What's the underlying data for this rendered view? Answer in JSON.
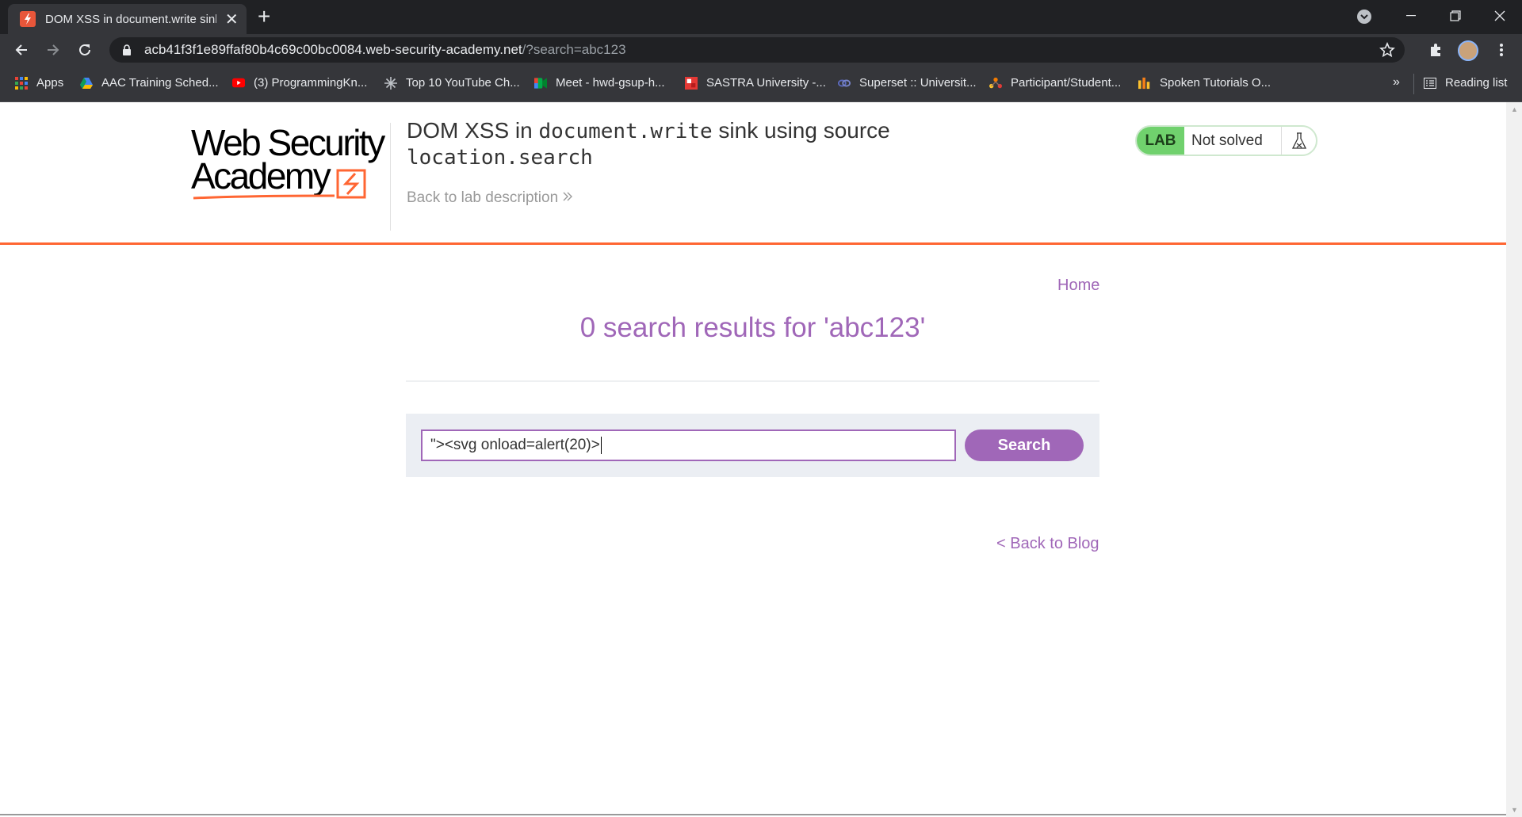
{
  "browser": {
    "tab": {
      "title": "DOM XSS in document.write sink",
      "close_glyph": "✕"
    },
    "new_tab_glyph": "+",
    "address": {
      "host": "acb41f3f1e89ffaf80b4c69c00bc0084.web-security-academy.net",
      "path": "/?search=abc123"
    },
    "bookmarks": [
      {
        "label": "Apps",
        "icon": "apps-grid-icon",
        "color": "#4285f4"
      },
      {
        "label": "AAC Training Sched...",
        "icon": "google-drive-icon",
        "color": "#4285f4"
      },
      {
        "label": "(3) ProgrammingKn...",
        "icon": "youtube-icon",
        "color": "#ff0000"
      },
      {
        "label": "Top 10 YouTube Ch...",
        "icon": "sparkle-icon",
        "color": "#bdc1c6"
      },
      {
        "label": "Meet - hwd-gsup-h...",
        "icon": "google-meet-icon",
        "color": "#00ac47"
      },
      {
        "label": "SASTRA University -...",
        "icon": "sastra-icon",
        "color": "#e53935"
      },
      {
        "label": "Superset :: Universit...",
        "icon": "superset-icon",
        "color": "#5c6bc0"
      },
      {
        "label": "Participant/Student...",
        "icon": "participant-icon",
        "color": "#f57c00"
      },
      {
        "label": "Spoken Tutorials O...",
        "icon": "spoken-tutorials-icon",
        "color": "#fbc02d"
      }
    ],
    "bookmarks_more": "»",
    "reading_list": "Reading list"
  },
  "page": {
    "logo": {
      "line1": "Web Security",
      "line2": "Academy"
    },
    "lab_title_prefix": "DOM XSS in ",
    "lab_title_code1": "document.write",
    "lab_title_middle": " sink using source",
    "lab_title_code2": "location.search",
    "back_to_description": "Back to lab description",
    "lab_badge": {
      "label": "LAB",
      "status": "Not solved"
    },
    "nav": {
      "home": "Home"
    },
    "results_heading": "0 search results for 'abc123'",
    "search": {
      "value": "\"><svg onload=alert(20)>",
      "button": "Search"
    },
    "back_to_blog": "< Back to Blog"
  },
  "colors": {
    "accent": "#a067b8",
    "brand_orange": "#ff6633",
    "lab_green": "#70d16d"
  }
}
